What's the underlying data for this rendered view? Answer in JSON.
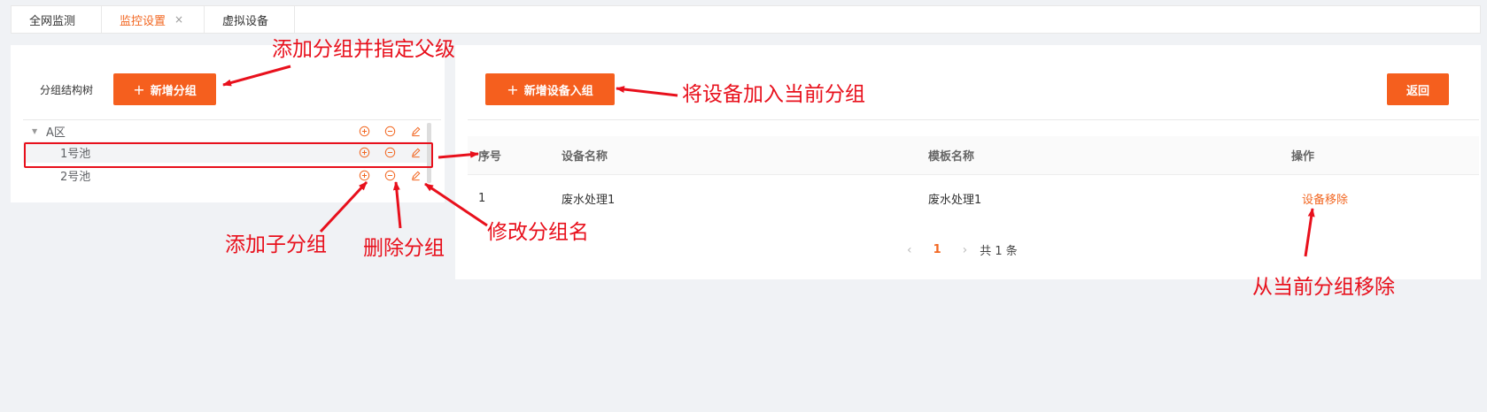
{
  "tabs": [
    {
      "label": "全网监测"
    },
    {
      "label": "监控设置",
      "close": "×"
    },
    {
      "label": "虚拟设备"
    }
  ],
  "left": {
    "tree_label": "分组结构树",
    "add_group_plus": "+",
    "add_group_label": "新增分组",
    "tree": [
      {
        "name": "A区"
      },
      {
        "name": "1号池"
      },
      {
        "name": "2号池"
      }
    ]
  },
  "right": {
    "add_device_plus": "+",
    "add_device_label": "新增设备入组",
    "back_label": "返回",
    "columns": [
      "序号",
      "设备名称",
      "模板名称",
      "操作"
    ],
    "rows": [
      {
        "index": "1",
        "device": "废水处理1",
        "template": "废水处理1",
        "action": "设备移除"
      }
    ],
    "pager": {
      "prev": "‹",
      "current": "1",
      "next": "›",
      "total": "共 1 条"
    }
  },
  "annotations": {
    "add_group": "添加分组并指定父级",
    "add_device": "将设备加入当前分组",
    "add_child": "添加子分组",
    "delete_group": "删除分组",
    "rename_group": "修改分组名",
    "remove_device": "从当前分组移除"
  },
  "colors": {
    "accent": "#f55f1e",
    "annotation": "#e8101c"
  }
}
